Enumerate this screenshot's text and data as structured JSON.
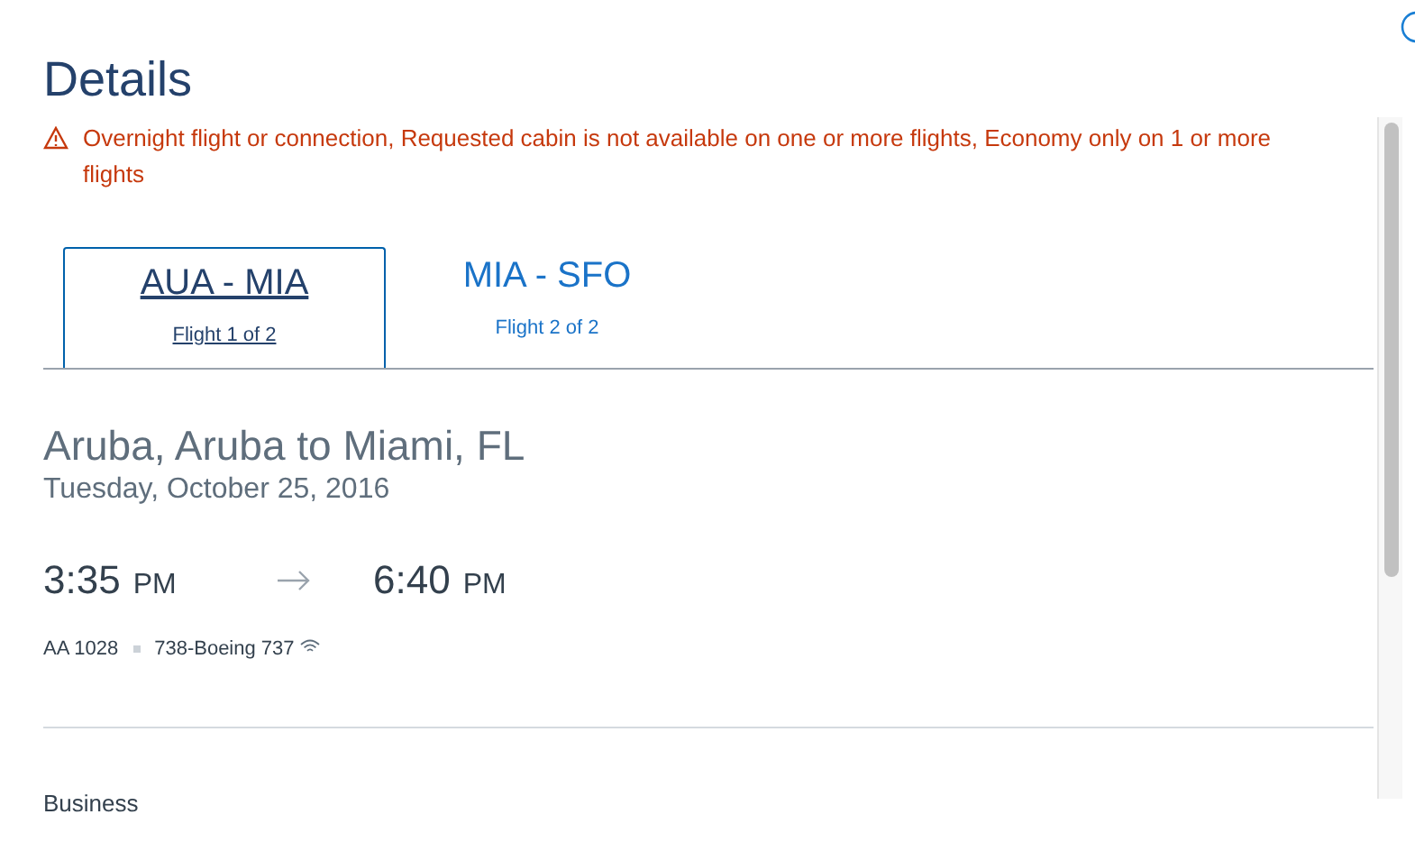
{
  "title": "Details",
  "warning": "Overnight flight or connection, Requested cabin is not available on one or more flights, Economy only on 1 or more flights",
  "tabs": [
    {
      "route": "AUA - MIA",
      "label": "Flight 1 of 2",
      "selected": true
    },
    {
      "route": "MIA - SFO",
      "label": "Flight 2 of 2",
      "selected": false
    }
  ],
  "flight": {
    "route": "Aruba, Aruba to Miami, FL",
    "date": "Tuesday, October 25, 2016",
    "depart_time": "3:35",
    "depart_period": "PM",
    "arrive_time": "6:40",
    "arrive_period": "PM",
    "number": "AA 1028",
    "aircraft": "738-Boeing 737"
  },
  "cabin": "Business"
}
